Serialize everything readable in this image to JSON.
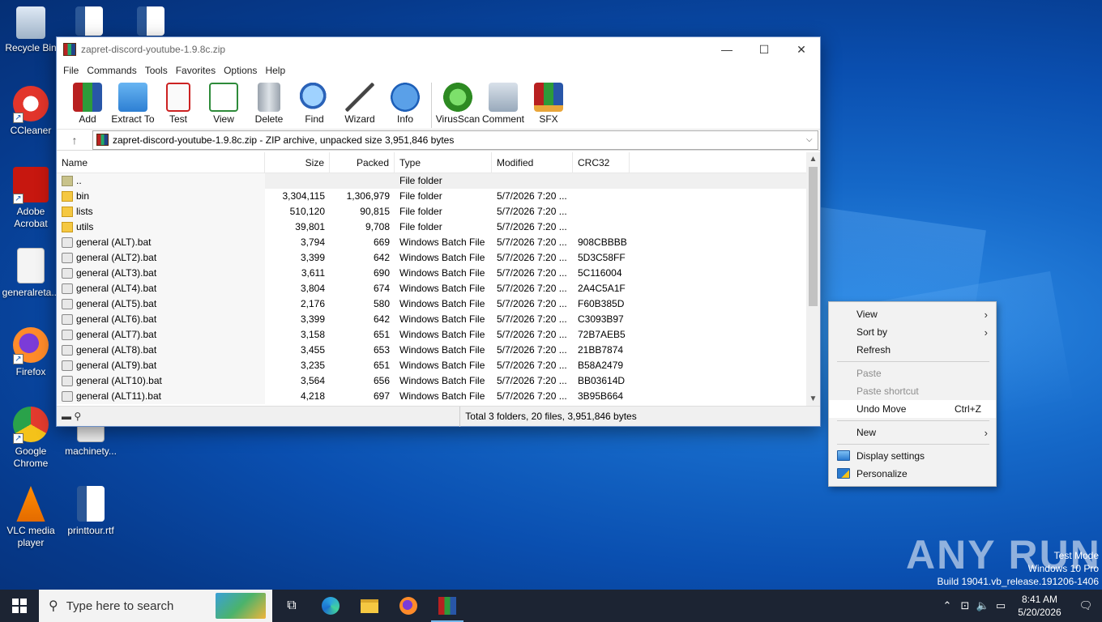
{
  "desktop": {
    "icons": [
      {
        "label": "Recycle Bin"
      },
      {
        "label": "CCleaner"
      },
      {
        "label": "Adobe Acrobat"
      },
      {
        "label": "generalreta..."
      },
      {
        "label": "Firefox"
      },
      {
        "label": "Google Chrome"
      },
      {
        "label": "machinety..."
      },
      {
        "label": "VLC media player"
      },
      {
        "label": "printtour.rtf"
      }
    ]
  },
  "winrar": {
    "title": "zapret-discord-youtube-1.9.8c.zip",
    "controls": {
      "minimize": "—",
      "maximize": "☐",
      "close": "✕"
    },
    "menu": [
      "File",
      "Commands",
      "Tools",
      "Favorites",
      "Options",
      "Help"
    ],
    "toolbar": [
      "Add",
      "Extract To",
      "Test",
      "View",
      "Delete",
      "Find",
      "Wizard",
      "Info",
      "VirusScan",
      "Comment",
      "SFX"
    ],
    "address": "zapret-discord-youtube-1.9.8c.zip - ZIP archive, unpacked size 3,951,846 bytes",
    "columns": {
      "name": "Name",
      "size": "Size",
      "packed": "Packed",
      "type": "Type",
      "modified": "Modified",
      "crc": "CRC32"
    },
    "rows": [
      {
        "name": "..",
        "size": "",
        "packed": "",
        "type": "File folder",
        "modified": "",
        "crc": "",
        "kind": "up"
      },
      {
        "name": "bin",
        "size": "3,304,115",
        "packed": "1,306,979",
        "type": "File folder",
        "modified": "5/7/2026 7:20 ...",
        "crc": "",
        "kind": "folder"
      },
      {
        "name": "lists",
        "size": "510,120",
        "packed": "90,815",
        "type": "File folder",
        "modified": "5/7/2026 7:20 ...",
        "crc": "",
        "kind": "folder"
      },
      {
        "name": "utils",
        "size": "39,801",
        "packed": "9,708",
        "type": "File folder",
        "modified": "5/7/2026 7:20 ...",
        "crc": "",
        "kind": "folder"
      },
      {
        "name": "general (ALT).bat",
        "size": "3,794",
        "packed": "669",
        "type": "Windows Batch File",
        "modified": "5/7/2026 7:20 ...",
        "crc": "908CBBBB",
        "kind": "bat"
      },
      {
        "name": "general (ALT2).bat",
        "size": "3,399",
        "packed": "642",
        "type": "Windows Batch File",
        "modified": "5/7/2026 7:20 ...",
        "crc": "5D3C58FF",
        "kind": "bat"
      },
      {
        "name": "general (ALT3).bat",
        "size": "3,611",
        "packed": "690",
        "type": "Windows Batch File",
        "modified": "5/7/2026 7:20 ...",
        "crc": "5C116004",
        "kind": "bat"
      },
      {
        "name": "general (ALT4).bat",
        "size": "3,804",
        "packed": "674",
        "type": "Windows Batch File",
        "modified": "5/7/2026 7:20 ...",
        "crc": "2A4C5A1F",
        "kind": "bat"
      },
      {
        "name": "general (ALT5).bat",
        "size": "2,176",
        "packed": "580",
        "type": "Windows Batch File",
        "modified": "5/7/2026 7:20 ...",
        "crc": "F60B385D",
        "kind": "bat"
      },
      {
        "name": "general (ALT6).bat",
        "size": "3,399",
        "packed": "642",
        "type": "Windows Batch File",
        "modified": "5/7/2026 7:20 ...",
        "crc": "C3093B97",
        "kind": "bat"
      },
      {
        "name": "general (ALT7).bat",
        "size": "3,158",
        "packed": "651",
        "type": "Windows Batch File",
        "modified": "5/7/2026 7:20 ...",
        "crc": "72B7AEB5",
        "kind": "bat"
      },
      {
        "name": "general (ALT8).bat",
        "size": "3,455",
        "packed": "653",
        "type": "Windows Batch File",
        "modified": "5/7/2026 7:20 ...",
        "crc": "21BB7874",
        "kind": "bat"
      },
      {
        "name": "general (ALT9).bat",
        "size": "3,235",
        "packed": "651",
        "type": "Windows Batch File",
        "modified": "5/7/2026 7:20 ...",
        "crc": "B58A2479",
        "kind": "bat"
      },
      {
        "name": "general (ALT10).bat",
        "size": "3,564",
        "packed": "656",
        "type": "Windows Batch File",
        "modified": "5/7/2026 7:20 ...",
        "crc": "BB03614D",
        "kind": "bat"
      },
      {
        "name": "general (ALT11).bat",
        "size": "4,218",
        "packed": "697",
        "type": "Windows Batch File",
        "modified": "5/7/2026 7:20 ...",
        "crc": "3B95B664",
        "kind": "bat"
      }
    ],
    "status": "Total 3 folders, 20 files, 3,951,846 bytes"
  },
  "context_menu": {
    "view": "View",
    "sort_by": "Sort by",
    "refresh": "Refresh",
    "paste": "Paste",
    "paste_shortcut": "Paste shortcut",
    "undo_move": "Undo Move",
    "undo_accel": "Ctrl+Z",
    "new": "New",
    "display_settings": "Display settings",
    "personalize": "Personalize"
  },
  "watermark": "ANY RUN",
  "sysinfo": {
    "line1": "Test Mode",
    "line2": "Windows 10 Pro",
    "line3": "Build 19041.vb_release.191206-1406"
  },
  "taskbar": {
    "search_placeholder": "Type here to search",
    "time": "8:41 AM",
    "date": "5/20/2026"
  },
  "colors": {
    "desktop_blue": "#0a4fb0",
    "taskbar": "#1c2433",
    "accent": "#76b9ed"
  }
}
